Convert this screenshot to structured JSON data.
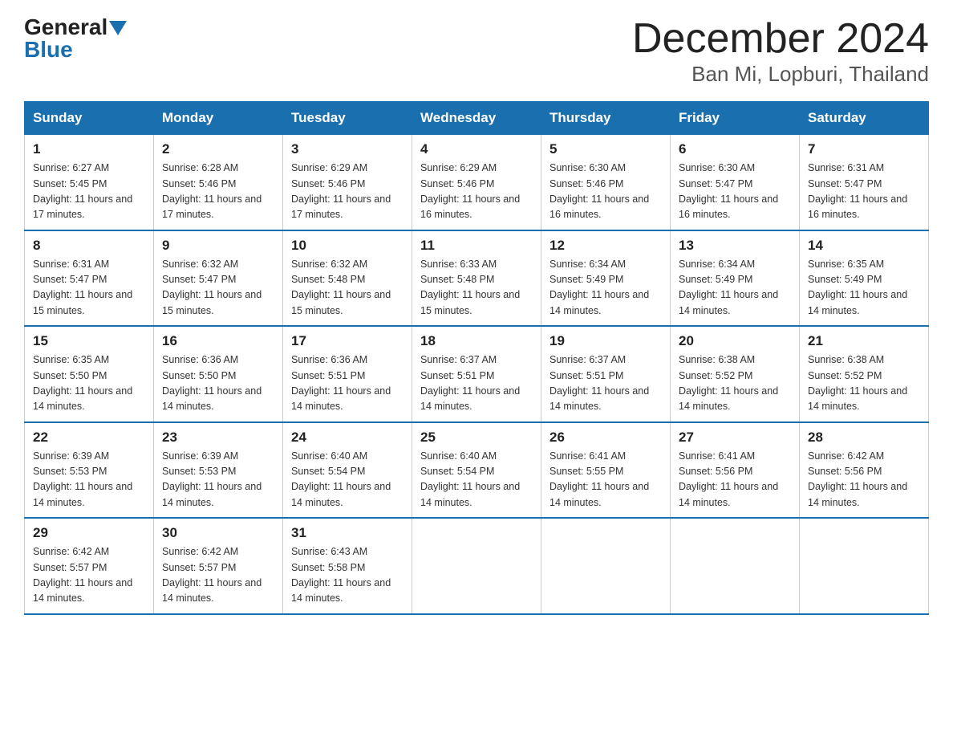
{
  "logo": {
    "general": "General",
    "blue": "Blue"
  },
  "title": "December 2024",
  "location": "Ban Mi, Lopburi, Thailand",
  "days_of_week": [
    "Sunday",
    "Monday",
    "Tuesday",
    "Wednesday",
    "Thursday",
    "Friday",
    "Saturday"
  ],
  "weeks": [
    [
      {
        "day": "1",
        "sunrise": "6:27 AM",
        "sunset": "5:45 PM",
        "daylight": "11 hours and 17 minutes."
      },
      {
        "day": "2",
        "sunrise": "6:28 AM",
        "sunset": "5:46 PM",
        "daylight": "11 hours and 17 minutes."
      },
      {
        "day": "3",
        "sunrise": "6:29 AM",
        "sunset": "5:46 PM",
        "daylight": "11 hours and 17 minutes."
      },
      {
        "day": "4",
        "sunrise": "6:29 AM",
        "sunset": "5:46 PM",
        "daylight": "11 hours and 16 minutes."
      },
      {
        "day": "5",
        "sunrise": "6:30 AM",
        "sunset": "5:46 PM",
        "daylight": "11 hours and 16 minutes."
      },
      {
        "day": "6",
        "sunrise": "6:30 AM",
        "sunset": "5:47 PM",
        "daylight": "11 hours and 16 minutes."
      },
      {
        "day": "7",
        "sunrise": "6:31 AM",
        "sunset": "5:47 PM",
        "daylight": "11 hours and 16 minutes."
      }
    ],
    [
      {
        "day": "8",
        "sunrise": "6:31 AM",
        "sunset": "5:47 PM",
        "daylight": "11 hours and 15 minutes."
      },
      {
        "day": "9",
        "sunrise": "6:32 AM",
        "sunset": "5:47 PM",
        "daylight": "11 hours and 15 minutes."
      },
      {
        "day": "10",
        "sunrise": "6:32 AM",
        "sunset": "5:48 PM",
        "daylight": "11 hours and 15 minutes."
      },
      {
        "day": "11",
        "sunrise": "6:33 AM",
        "sunset": "5:48 PM",
        "daylight": "11 hours and 15 minutes."
      },
      {
        "day": "12",
        "sunrise": "6:34 AM",
        "sunset": "5:49 PM",
        "daylight": "11 hours and 14 minutes."
      },
      {
        "day": "13",
        "sunrise": "6:34 AM",
        "sunset": "5:49 PM",
        "daylight": "11 hours and 14 minutes."
      },
      {
        "day": "14",
        "sunrise": "6:35 AM",
        "sunset": "5:49 PM",
        "daylight": "11 hours and 14 minutes."
      }
    ],
    [
      {
        "day": "15",
        "sunrise": "6:35 AM",
        "sunset": "5:50 PM",
        "daylight": "11 hours and 14 minutes."
      },
      {
        "day": "16",
        "sunrise": "6:36 AM",
        "sunset": "5:50 PM",
        "daylight": "11 hours and 14 minutes."
      },
      {
        "day": "17",
        "sunrise": "6:36 AM",
        "sunset": "5:51 PM",
        "daylight": "11 hours and 14 minutes."
      },
      {
        "day": "18",
        "sunrise": "6:37 AM",
        "sunset": "5:51 PM",
        "daylight": "11 hours and 14 minutes."
      },
      {
        "day": "19",
        "sunrise": "6:37 AM",
        "sunset": "5:51 PM",
        "daylight": "11 hours and 14 minutes."
      },
      {
        "day": "20",
        "sunrise": "6:38 AM",
        "sunset": "5:52 PM",
        "daylight": "11 hours and 14 minutes."
      },
      {
        "day": "21",
        "sunrise": "6:38 AM",
        "sunset": "5:52 PM",
        "daylight": "11 hours and 14 minutes."
      }
    ],
    [
      {
        "day": "22",
        "sunrise": "6:39 AM",
        "sunset": "5:53 PM",
        "daylight": "11 hours and 14 minutes."
      },
      {
        "day": "23",
        "sunrise": "6:39 AM",
        "sunset": "5:53 PM",
        "daylight": "11 hours and 14 minutes."
      },
      {
        "day": "24",
        "sunrise": "6:40 AM",
        "sunset": "5:54 PM",
        "daylight": "11 hours and 14 minutes."
      },
      {
        "day": "25",
        "sunrise": "6:40 AM",
        "sunset": "5:54 PM",
        "daylight": "11 hours and 14 minutes."
      },
      {
        "day": "26",
        "sunrise": "6:41 AM",
        "sunset": "5:55 PM",
        "daylight": "11 hours and 14 minutes."
      },
      {
        "day": "27",
        "sunrise": "6:41 AM",
        "sunset": "5:56 PM",
        "daylight": "11 hours and 14 minutes."
      },
      {
        "day": "28",
        "sunrise": "6:42 AM",
        "sunset": "5:56 PM",
        "daylight": "11 hours and 14 minutes."
      }
    ],
    [
      {
        "day": "29",
        "sunrise": "6:42 AM",
        "sunset": "5:57 PM",
        "daylight": "11 hours and 14 minutes."
      },
      {
        "day": "30",
        "sunrise": "6:42 AM",
        "sunset": "5:57 PM",
        "daylight": "11 hours and 14 minutes."
      },
      {
        "day": "31",
        "sunrise": "6:43 AM",
        "sunset": "5:58 PM",
        "daylight": "11 hours and 14 minutes."
      },
      null,
      null,
      null,
      null
    ]
  ]
}
